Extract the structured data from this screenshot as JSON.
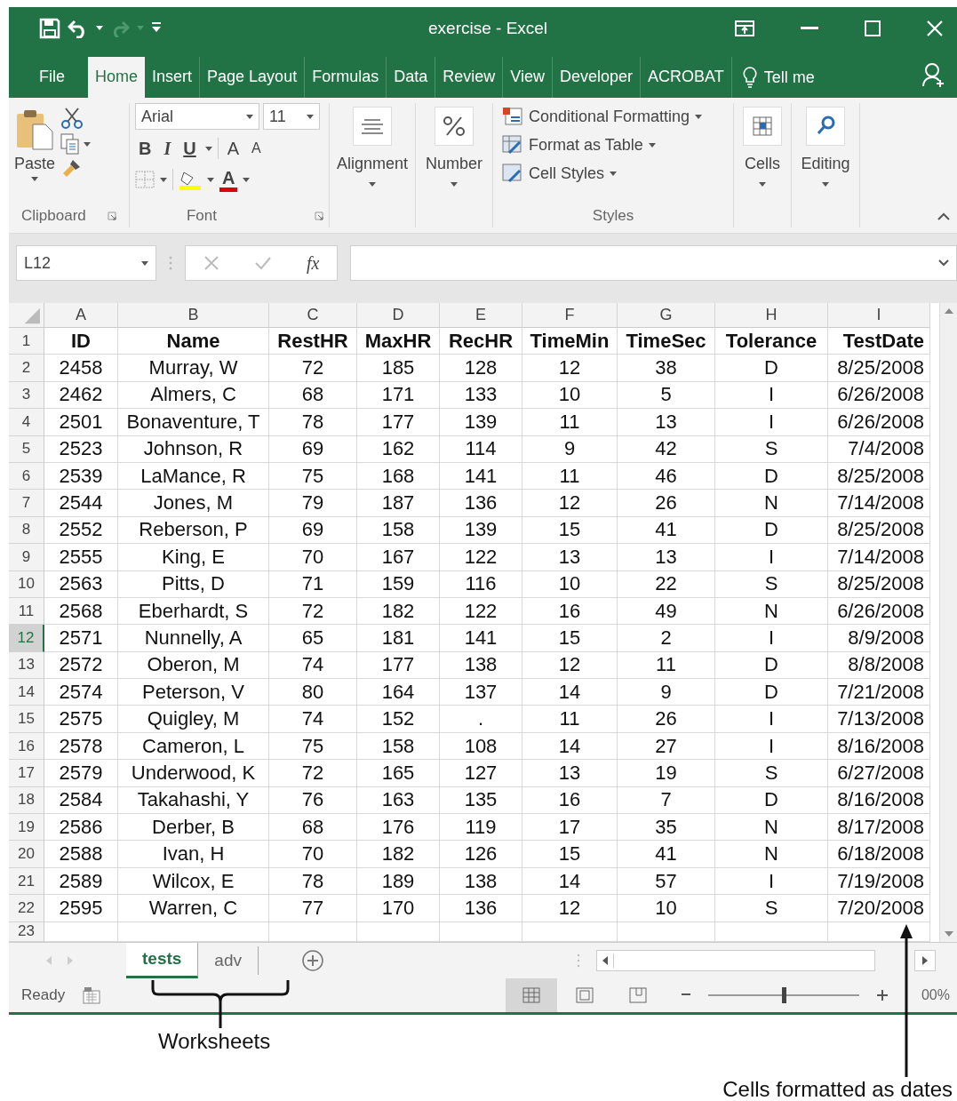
{
  "window": {
    "title": "exercise  -  Excel"
  },
  "ribbon_tabs": [
    {
      "label": "File",
      "selected": false
    },
    {
      "label": "Home",
      "selected": true
    },
    {
      "label": "Insert",
      "selected": false
    },
    {
      "label": "Page Layout",
      "selected": false
    },
    {
      "label": "Formulas",
      "selected": false
    },
    {
      "label": "Data",
      "selected": false
    },
    {
      "label": "Review",
      "selected": false
    },
    {
      "label": "View",
      "selected": false
    },
    {
      "label": "Developer",
      "selected": false
    },
    {
      "label": "ACROBAT",
      "selected": false
    }
  ],
  "tell_me": "Tell me",
  "ribbon": {
    "clipboard": {
      "label": "Clipboard",
      "paste": "Paste"
    },
    "font": {
      "label": "Font",
      "font_name": "Arial",
      "size_value": "11",
      "style_buttons": [
        "B",
        "I",
        "U"
      ],
      "size_buttons": [
        "A",
        "A"
      ],
      "color_button": "A"
    },
    "alignment": {
      "label": "Alignment"
    },
    "number": {
      "label": "Number"
    },
    "styles": {
      "label": "Styles",
      "items": [
        "Conditional Formatting",
        "Format as Table",
        "Cell Styles"
      ]
    },
    "cells": {
      "label": "Cells"
    },
    "editing": {
      "label": "Editing"
    }
  },
  "formula_bar": {
    "name_box": "L12",
    "fx": "fx"
  },
  "sheet": {
    "columns": [
      "A",
      "B",
      "C",
      "D",
      "E",
      "F",
      "G",
      "H",
      "I"
    ],
    "rows": [
      {
        "number": "1",
        "kind": "header",
        "selected": false,
        "cells": [
          "ID",
          "Name",
          "RestHR",
          "MaxHR",
          "RecHR",
          "TimeMin",
          "TimeSec",
          "Tolerance",
          "TestDate"
        ]
      },
      {
        "number": "2",
        "kind": "data",
        "selected": false,
        "cells": [
          "2458",
          "Murray, W",
          "72",
          "185",
          "128",
          "12",
          "38",
          "D",
          "8/25/2008"
        ]
      },
      {
        "number": "3",
        "kind": "data",
        "selected": false,
        "cells": [
          "2462",
          "Almers, C",
          "68",
          "171",
          "133",
          "10",
          "5",
          "I",
          "6/26/2008"
        ]
      },
      {
        "number": "4",
        "kind": "data",
        "selected": false,
        "cells": [
          "2501",
          "Bonaventure, T",
          "78",
          "177",
          "139",
          "11",
          "13",
          "I",
          "6/26/2008"
        ]
      },
      {
        "number": "5",
        "kind": "data",
        "selected": false,
        "cells": [
          "2523",
          "Johnson, R",
          "69",
          "162",
          "114",
          "9",
          "42",
          "S",
          "7/4/2008"
        ]
      },
      {
        "number": "6",
        "kind": "data",
        "selected": false,
        "cells": [
          "2539",
          "LaMance, R",
          "75",
          "168",
          "141",
          "11",
          "46",
          "D",
          "8/25/2008"
        ]
      },
      {
        "number": "7",
        "kind": "data",
        "selected": false,
        "cells": [
          "2544",
          "Jones, M",
          "79",
          "187",
          "136",
          "12",
          "26",
          "N",
          "7/14/2008"
        ]
      },
      {
        "number": "8",
        "kind": "data",
        "selected": false,
        "cells": [
          "2552",
          "Reberson, P",
          "69",
          "158",
          "139",
          "15",
          "41",
          "D",
          "8/25/2008"
        ]
      },
      {
        "number": "9",
        "kind": "data",
        "selected": false,
        "cells": [
          "2555",
          "King, E",
          "70",
          "167",
          "122",
          "13",
          "13",
          "I",
          "7/14/2008"
        ]
      },
      {
        "number": "10",
        "kind": "data",
        "selected": false,
        "cells": [
          "2563",
          "Pitts, D",
          "71",
          "159",
          "116",
          "10",
          "22",
          "S",
          "8/25/2008"
        ]
      },
      {
        "number": "11",
        "kind": "data",
        "selected": false,
        "cells": [
          "2568",
          "Eberhardt, S",
          "72",
          "182",
          "122",
          "16",
          "49",
          "N",
          "6/26/2008"
        ]
      },
      {
        "number": "12",
        "kind": "data",
        "selected": true,
        "cells": [
          "2571",
          "Nunnelly, A",
          "65",
          "181",
          "141",
          "15",
          "2",
          "I",
          "8/9/2008"
        ]
      },
      {
        "number": "13",
        "kind": "data",
        "selected": false,
        "cells": [
          "2572",
          "Oberon, M",
          "74",
          "177",
          "138",
          "12",
          "11",
          "D",
          "8/8/2008"
        ]
      },
      {
        "number": "14",
        "kind": "data",
        "selected": false,
        "cells": [
          "2574",
          "Peterson, V",
          "80",
          "164",
          "137",
          "14",
          "9",
          "D",
          "7/21/2008"
        ]
      },
      {
        "number": "15",
        "kind": "data",
        "selected": false,
        "cells": [
          "2575",
          "Quigley, M",
          "74",
          "152",
          ".",
          "11",
          "26",
          "I",
          "7/13/2008"
        ]
      },
      {
        "number": "16",
        "kind": "data",
        "selected": false,
        "cells": [
          "2578",
          "Cameron, L",
          "75",
          "158",
          "108",
          "14",
          "27",
          "I",
          "8/16/2008"
        ]
      },
      {
        "number": "17",
        "kind": "data",
        "selected": false,
        "cells": [
          "2579",
          "Underwood, K",
          "72",
          "165",
          "127",
          "13",
          "19",
          "S",
          "6/27/2008"
        ]
      },
      {
        "number": "18",
        "kind": "data",
        "selected": false,
        "cells": [
          "2584",
          "Takahashi, Y",
          "76",
          "163",
          "135",
          "16",
          "7",
          "D",
          "8/16/2008"
        ]
      },
      {
        "number": "19",
        "kind": "data",
        "selected": false,
        "cells": [
          "2586",
          "Derber, B",
          "68",
          "176",
          "119",
          "17",
          "35",
          "N",
          "8/17/2008"
        ]
      },
      {
        "number": "20",
        "kind": "data",
        "selected": false,
        "cells": [
          "2588",
          "Ivan, H",
          "70",
          "182",
          "126",
          "15",
          "41",
          "N",
          "6/18/2008"
        ]
      },
      {
        "number": "21",
        "kind": "data",
        "selected": false,
        "cells": [
          "2589",
          "Wilcox, E",
          "78",
          "189",
          "138",
          "14",
          "57",
          "I",
          "7/19/2008"
        ]
      },
      {
        "number": "22",
        "kind": "data",
        "selected": false,
        "cells": [
          "2595",
          "Warren, C",
          "77",
          "170",
          "136",
          "12",
          "10",
          "S",
          "7/20/2008"
        ]
      },
      {
        "number": "23",
        "kind": "data",
        "selected": false
      }
    ]
  },
  "sheet_tabs": [
    {
      "label": "tests",
      "selected": true
    },
    {
      "label": "adv",
      "selected": false
    }
  ],
  "status_bar": {
    "status": "Ready",
    "zoom": "00%",
    "zoom_slider": {
      "level": 0.5
    }
  },
  "annotations": {
    "worksheets": "Worksheets",
    "dates": "Cells formatted as dates"
  }
}
